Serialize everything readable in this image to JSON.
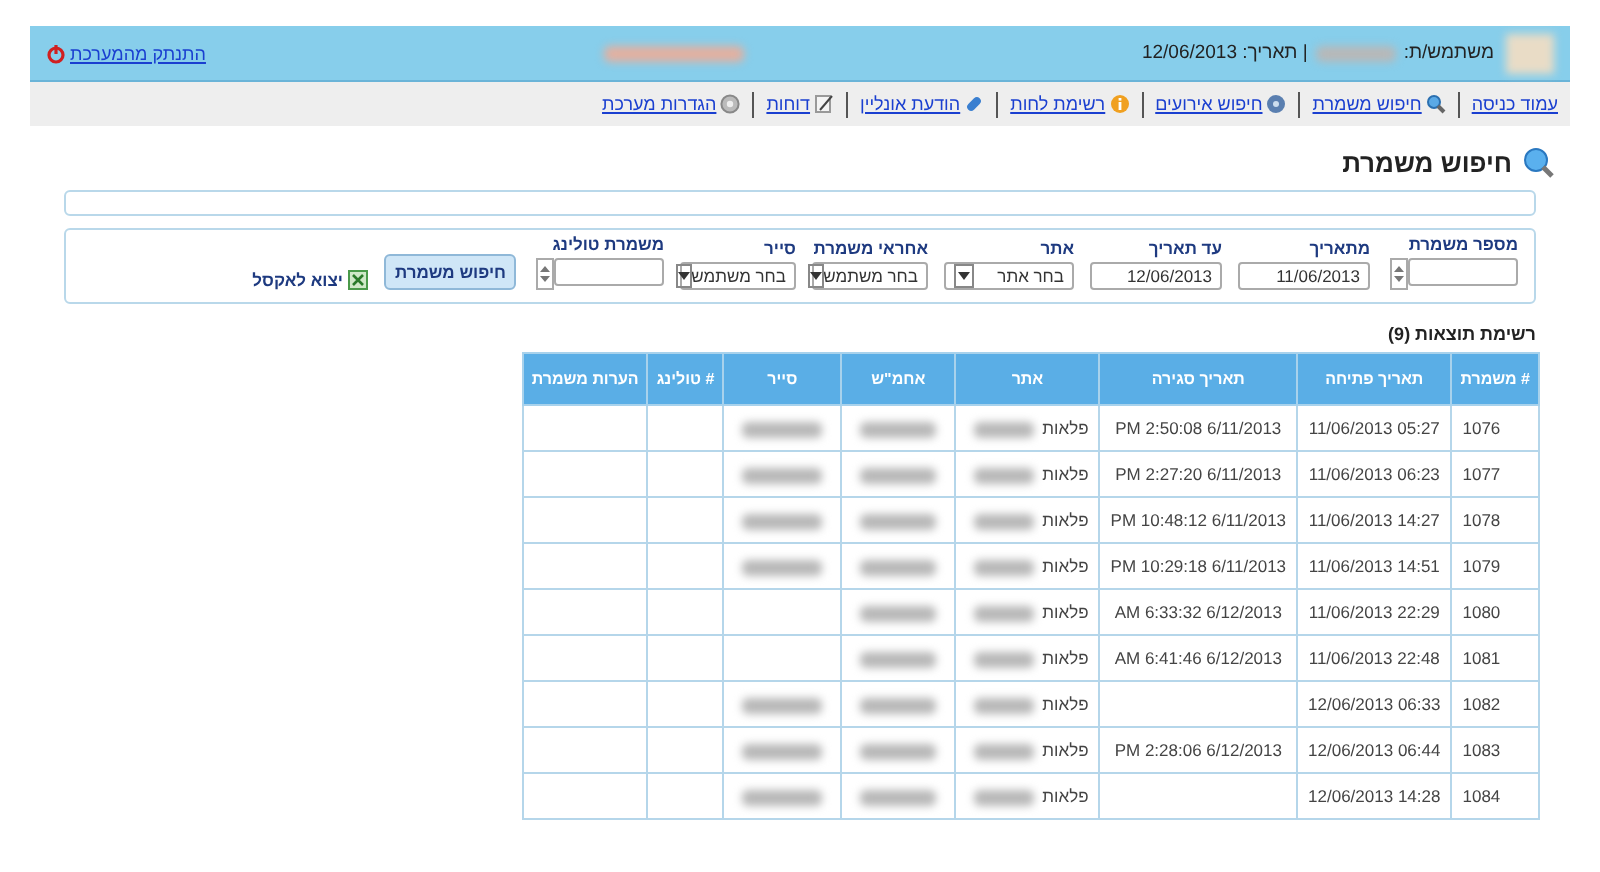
{
  "header": {
    "user_label": "משתמש/ת:",
    "user_redacted": true,
    "date_label": "| תאריך: 12/06/2013",
    "title_redacted": true,
    "logout": "התנתק מהמערכת"
  },
  "nav": [
    {
      "label": "עמוד כניסה"
    },
    {
      "label": "חיפוש משמרת"
    },
    {
      "label": "חיפוש אירועים"
    },
    {
      "label": "רשימת לחות"
    },
    {
      "label": "הודעת אונליין"
    },
    {
      "label": "דוחות"
    },
    {
      "label": "הגדרות מערכת"
    }
  ],
  "page_title": "חיפוש משמרת",
  "filters": [
    {
      "kind": "number",
      "label": "מספר משמרת"
    },
    {
      "kind": "date",
      "label": "מתאריך",
      "value": "11/06/2013"
    },
    {
      "kind": "date",
      "label": "עד תאריך",
      "value": "12/06/2013"
    },
    {
      "kind": "select",
      "label": "אתר",
      "value": "בחר אתר"
    },
    {
      "kind": "select",
      "label": "אחראי משמרת",
      "value": "בחר משתמש"
    },
    {
      "kind": "select",
      "label": "סייר",
      "value": "בחר משתמש"
    },
    {
      "kind": "number",
      "label": "משמרת טולינג"
    }
  ],
  "search_button": "חיפוש משמרת",
  "export_link": "יצוא לאקסל",
  "results_label": "רשימת תוצאות (9)",
  "table": {
    "columns": [
      "# משמרת",
      "תאריך פתיחה",
      "תאריך סגירה",
      "אתר",
      "אחמ\"ש",
      "סייר",
      "# טולינג",
      "הערות משמרת"
    ],
    "rows": [
      {
        "shift": "1076",
        "opened": "05:27 11/06/2013",
        "closed": "PM 2:50:08 6/11/2013",
        "site": "פלאות",
        "site_redacted": true,
        "manager_redacted": true,
        "patrol_redacted": true
      },
      {
        "shift": "1077",
        "opened": "06:23 11/06/2013",
        "closed": "PM 2:27:20 6/11/2013",
        "site": "פלאות",
        "site_redacted": true,
        "manager_redacted": true,
        "patrol_redacted": true
      },
      {
        "shift": "1078",
        "opened": "14:27 11/06/2013",
        "closed": "PM 10:48:12 6/11/2013",
        "site": "פלאות",
        "site_redacted": true,
        "manager_redacted": true,
        "patrol_redacted": true
      },
      {
        "shift": "1079",
        "opened": "14:51 11/06/2013",
        "closed": "PM 10:29:18 6/11/2013",
        "site": "פלאות",
        "site_redacted": true,
        "manager_redacted": true,
        "patrol_redacted": true
      },
      {
        "shift": "1080",
        "opened": "22:29 11/06/2013",
        "closed": "AM 6:33:32 6/12/2013",
        "site": "פלאות",
        "site_redacted": true,
        "manager_redacted": true,
        "patrol_redacted": false
      },
      {
        "shift": "1081",
        "opened": "22:48 11/06/2013",
        "closed": "AM 6:41:46 6/12/2013",
        "site": "פלאות",
        "site_redacted": true,
        "manager_redacted": true,
        "patrol_redacted": false
      },
      {
        "shift": "1082",
        "opened": "06:33 12/06/2013",
        "closed": "",
        "site": "פלאות",
        "site_redacted": true,
        "manager_redacted": true,
        "patrol_redacted": true
      },
      {
        "shift": "1083",
        "opened": "06:44 12/06/2013",
        "closed": "PM 2:28:06 6/12/2013",
        "site": "פלאות",
        "site_redacted": true,
        "manager_redacted": true,
        "patrol_redacted": true
      },
      {
        "shift": "1084",
        "opened": "14:28 12/06/2013",
        "closed": "",
        "site": "פלאות",
        "site_redacted": true,
        "manager_redacted": true,
        "patrol_redacted": true
      }
    ]
  }
}
